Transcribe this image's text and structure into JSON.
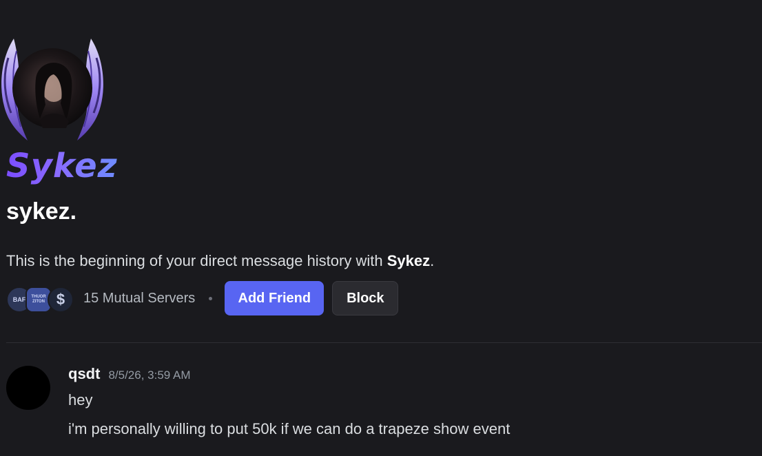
{
  "profile": {
    "display_name": "Sykez",
    "username": "sykez.",
    "intro_prefix": "This is the beginning of your direct message history with ",
    "intro_name": "Sykez",
    "intro_suffix": "."
  },
  "mutual": {
    "servers": [
      {
        "label": "BAF"
      },
      {
        "label": "THUOR ZITON"
      },
      {
        "label": "$"
      }
    ],
    "count_label": "15 Mutual Servers"
  },
  "actions": {
    "add_friend_label": "Add Friend",
    "block_label": "Block"
  },
  "messages": [
    {
      "author": "qsdt",
      "timestamp": "8/5/26, 3:59 AM",
      "lines": [
        "hey",
        "i'm personally willing to put 50k if we can do a trapeze show event"
      ]
    }
  ],
  "colors": {
    "background": "#1a1a1e",
    "accent": "#5865f2",
    "display_name_gradient_start": "#7b4dff",
    "display_name_gradient_end": "#6e8cff"
  }
}
